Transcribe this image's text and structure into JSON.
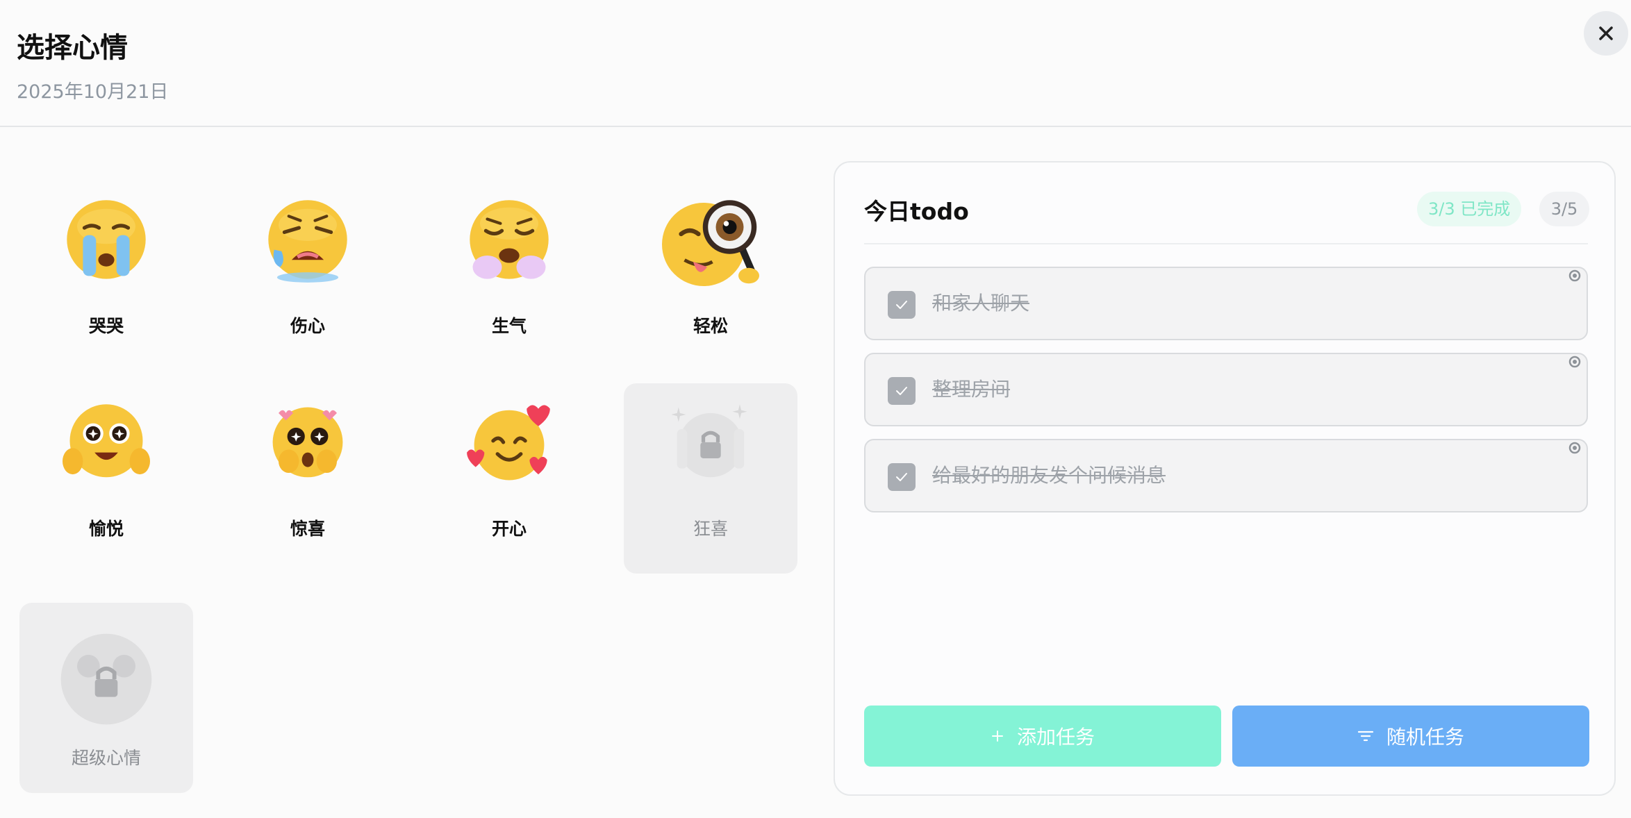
{
  "header": {
    "title": "选择心情",
    "date": "2025年10月21日",
    "close_icon": "close-icon"
  },
  "moods": [
    {
      "label": "哭哭",
      "icon": "crying-face-icon",
      "locked": false
    },
    {
      "label": "伤心",
      "icon": "sad-face-icon",
      "locked": false
    },
    {
      "label": "生气",
      "icon": "angry-face-icon",
      "locked": false
    },
    {
      "label": "轻松",
      "icon": "magnifier-face-icon",
      "locked": false
    },
    {
      "label": "愉悦",
      "icon": "star-eyes-face-icon",
      "locked": false
    },
    {
      "label": "惊喜",
      "icon": "surprised-face-icon",
      "locked": false
    },
    {
      "label": "开心",
      "icon": "hearts-face-icon",
      "locked": false
    },
    {
      "label": "狂喜",
      "icon": "locked-mood-icon",
      "locked": true
    },
    {
      "label": "超级心情",
      "icon": "locked-mood-icon",
      "locked": true
    }
  ],
  "todo": {
    "title": "今日todo",
    "done_badge": "3/3 已完成",
    "count_badge": "3/5",
    "tasks": [
      {
        "text": "和家人聊天",
        "done": true
      },
      {
        "text": "整理房间",
        "done": true
      },
      {
        "text": "给最好的朋友发个问候消息",
        "done": true
      }
    ],
    "add_button": "添加任务",
    "random_button": "随机任务"
  },
  "colors": {
    "accent_green": "#84f3d6",
    "accent_blue": "#6aaef6",
    "done_text": "#7fe6c6"
  }
}
